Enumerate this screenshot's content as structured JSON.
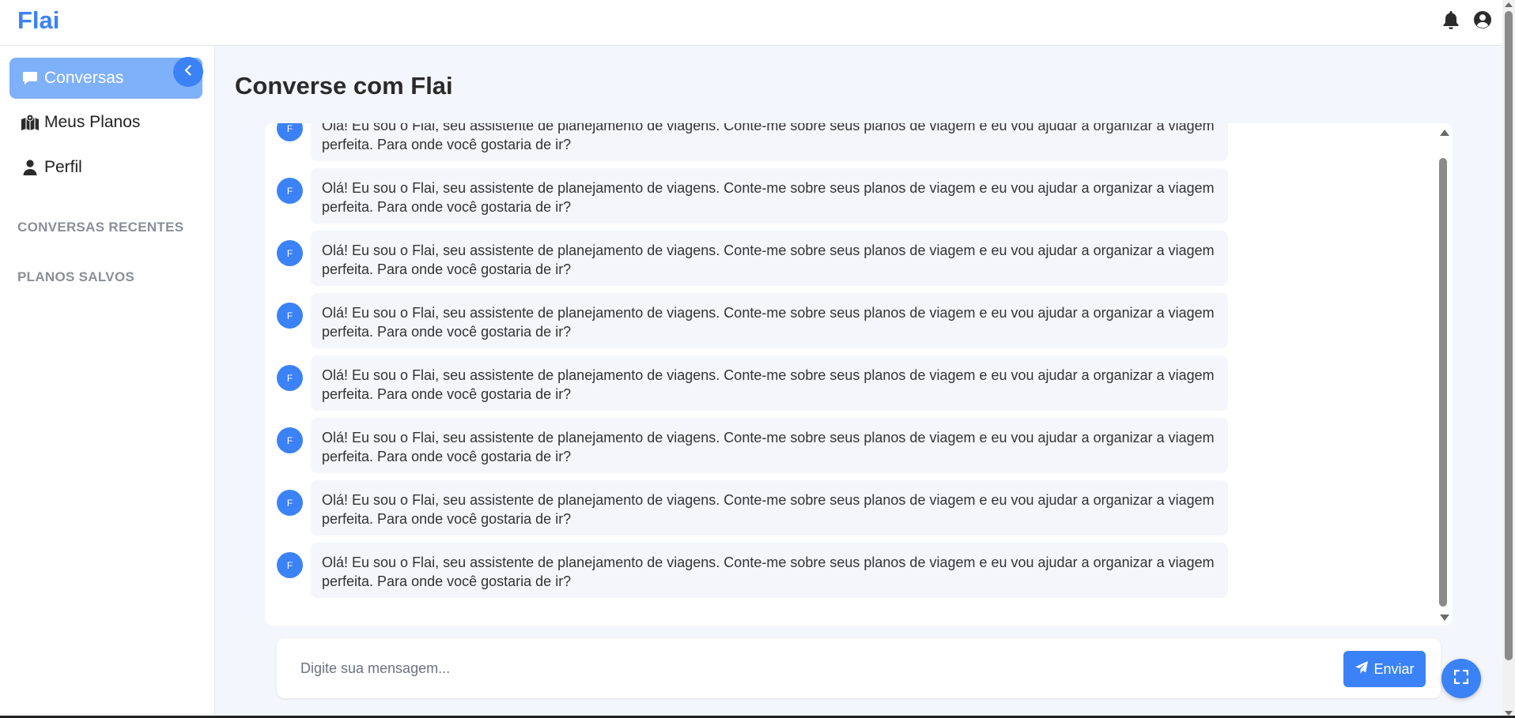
{
  "app": {
    "brand": "Flai"
  },
  "header": {
    "icons": [
      "bell-icon",
      "user-circle-icon"
    ]
  },
  "sidebar": {
    "items": [
      {
        "label": "Conversas",
        "icon": "comment-icon",
        "active": true
      },
      {
        "label": "Meus Planos",
        "icon": "map-icon",
        "active": false
      },
      {
        "label": "Perfil",
        "icon": "user-icon",
        "active": false
      }
    ],
    "sections": [
      "CONVERSAS RECENTES",
      "PLANOS SALVOS"
    ],
    "collapse_icon": "chevron-left-icon"
  },
  "main": {
    "title": "Converse com Flai",
    "messages": [
      {
        "avatar": "F",
        "text": "Olá! Eu sou o Flai, seu assistente de planejamento de viagens. Conte-me sobre seus planos de viagem e eu vou ajudar a organizar a viagem perfeita. Para onde você gostaria de ir?"
      },
      {
        "avatar": "F",
        "text": "Olá! Eu sou o Flai, seu assistente de planejamento de viagens. Conte-me sobre seus planos de viagem e eu vou ajudar a organizar a viagem perfeita. Para onde você gostaria de ir?"
      },
      {
        "avatar": "F",
        "text": "Olá! Eu sou o Flai, seu assistente de planejamento de viagens. Conte-me sobre seus planos de viagem e eu vou ajudar a organizar a viagem perfeita. Para onde você gostaria de ir?"
      },
      {
        "avatar": "F",
        "text": "Olá! Eu sou o Flai, seu assistente de planejamento de viagens. Conte-me sobre seus planos de viagem e eu vou ajudar a organizar a viagem perfeita. Para onde você gostaria de ir?"
      },
      {
        "avatar": "F",
        "text": "Olá! Eu sou o Flai, seu assistente de planejamento de viagens. Conte-me sobre seus planos de viagem e eu vou ajudar a organizar a viagem perfeita. Para onde você gostaria de ir?"
      },
      {
        "avatar": "F",
        "text": "Olá! Eu sou o Flai, seu assistente de planejamento de viagens. Conte-me sobre seus planos de viagem e eu vou ajudar a organizar a viagem perfeita. Para onde você gostaria de ir?"
      },
      {
        "avatar": "F",
        "text": "Olá! Eu sou o Flai, seu assistente de planejamento de viagens. Conte-me sobre seus planos de viagem e eu vou ajudar a organizar a viagem perfeita. Para onde você gostaria de ir?"
      },
      {
        "avatar": "F",
        "text": "Olá! Eu sou o Flai, seu assistente de planejamento de viagens. Conte-me sobre seus planos de viagem e eu vou ajudar a organizar a viagem perfeita. Para onde você gostaria de ir?"
      }
    ]
  },
  "composer": {
    "placeholder": "Digite sua mensagem...",
    "value": "",
    "send_label": "Enviar",
    "send_icon": "paper-plane-icon"
  },
  "fullscreen": {
    "icon": "expand-icon"
  },
  "colors": {
    "accent": "#3b82f6",
    "active_nav": "#7fb1fa",
    "background": "#f3f6fc",
    "bubble": "#f4f6fb"
  }
}
